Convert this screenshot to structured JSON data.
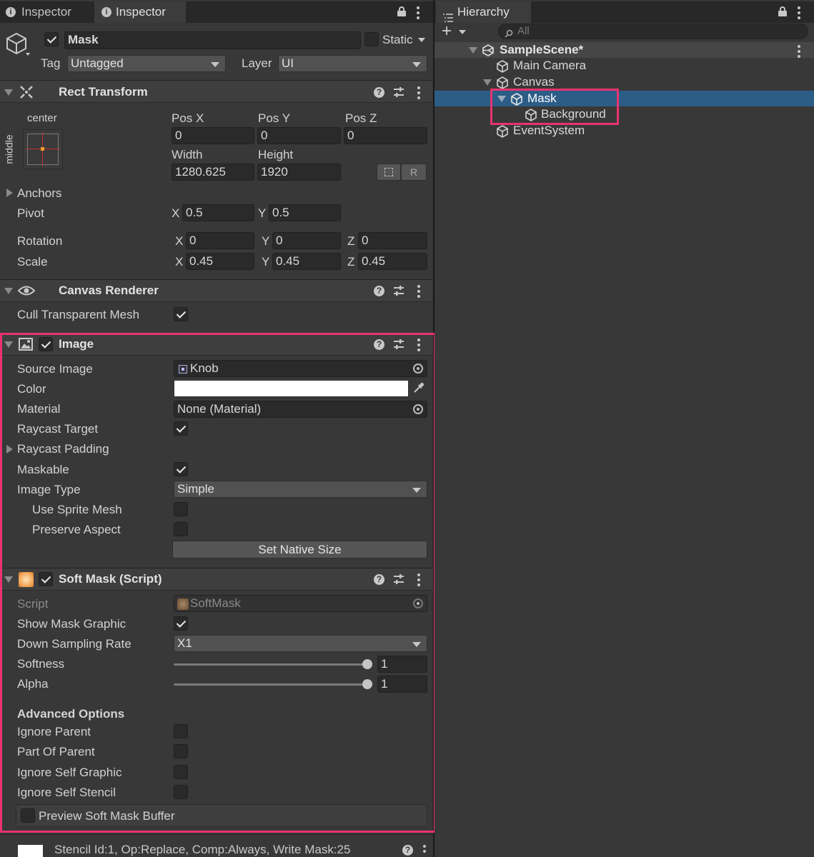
{
  "tabs": {
    "inspector1": "Inspector",
    "inspector2": "Inspector",
    "hierarchy": "Hierarchy"
  },
  "object": {
    "name": "Mask",
    "static_label": "Static",
    "tag_label": "Tag",
    "tag_value": "Untagged",
    "layer_label": "Layer",
    "layer_value": "UI"
  },
  "rect_transform": {
    "title": "Rect Transform",
    "anchor_h": "center",
    "anchor_v": "middle",
    "posx_label": "Pos X",
    "posy_label": "Pos Y",
    "posz_label": "Pos Z",
    "posx": "0",
    "posy": "0",
    "posz": "0",
    "width_label": "Width",
    "height_label": "Height",
    "width": "1280.625",
    "height": "1920",
    "r_button": "R",
    "anchors_label": "Anchors",
    "pivot_label": "Pivot",
    "pivot_x": "0.5",
    "pivot_y": "0.5",
    "rotation_label": "Rotation",
    "rot_x": "0",
    "rot_y": "0",
    "rot_z": "0",
    "scale_label": "Scale",
    "scale_x": "0.45",
    "scale_y": "0.45",
    "scale_z": "0.45",
    "x": "X",
    "y": "Y",
    "z": "Z"
  },
  "canvas_renderer": {
    "title": "Canvas Renderer",
    "cull_label": "Cull Transparent Mesh",
    "cull": true
  },
  "image": {
    "title": "Image",
    "enabled": true,
    "source_label": "Source Image",
    "source_value": "Knob",
    "color_label": "Color",
    "color_value": "#ffffff",
    "material_label": "Material",
    "material_value": "None (Material)",
    "raycast_label": "Raycast Target",
    "raycast": true,
    "raycast_padding_label": "Raycast Padding",
    "maskable_label": "Maskable",
    "maskable": true,
    "image_type_label": "Image Type",
    "image_type_value": "Simple",
    "use_sprite_mesh_label": "Use Sprite Mesh",
    "use_sprite_mesh": false,
    "preserve_aspect_label": "Preserve Aspect",
    "preserve_aspect": false,
    "native_size_button": "Set Native Size"
  },
  "soft_mask": {
    "title": "Soft Mask (Script)",
    "enabled": true,
    "script_label": "Script",
    "script_value": "SoftMask",
    "show_graphic_label": "Show Mask Graphic",
    "show_graphic": true,
    "down_sampling_label": "Down Sampling Rate",
    "down_sampling_value": "X1",
    "softness_label": "Softness",
    "softness_value": "1",
    "softness_fraction": 1.0,
    "alpha_label": "Alpha",
    "alpha_value": "1",
    "alpha_fraction": 1.0,
    "advanced_label": "Advanced Options",
    "ignore_parent_label": "Ignore Parent",
    "part_of_parent_label": "Part Of Parent",
    "ignore_self_graphic_label": "Ignore Self Graphic",
    "ignore_self_stencil_label": "Ignore Self Stencil",
    "preview_label": "Preview Soft Mask Buffer"
  },
  "footer": {
    "stencil_text": "Stencil Id:1, Op:Replace, Comp:Always, Write Mask:25"
  },
  "hierarchy": {
    "search_placeholder": "All",
    "scene": "SampleScene*",
    "items": [
      "Main Camera",
      "Canvas",
      "Mask",
      "Background",
      "EventSystem"
    ]
  },
  "colors": {
    "highlight": "#e8336d",
    "selection": "#2c5d87",
    "panel": "#383838"
  }
}
